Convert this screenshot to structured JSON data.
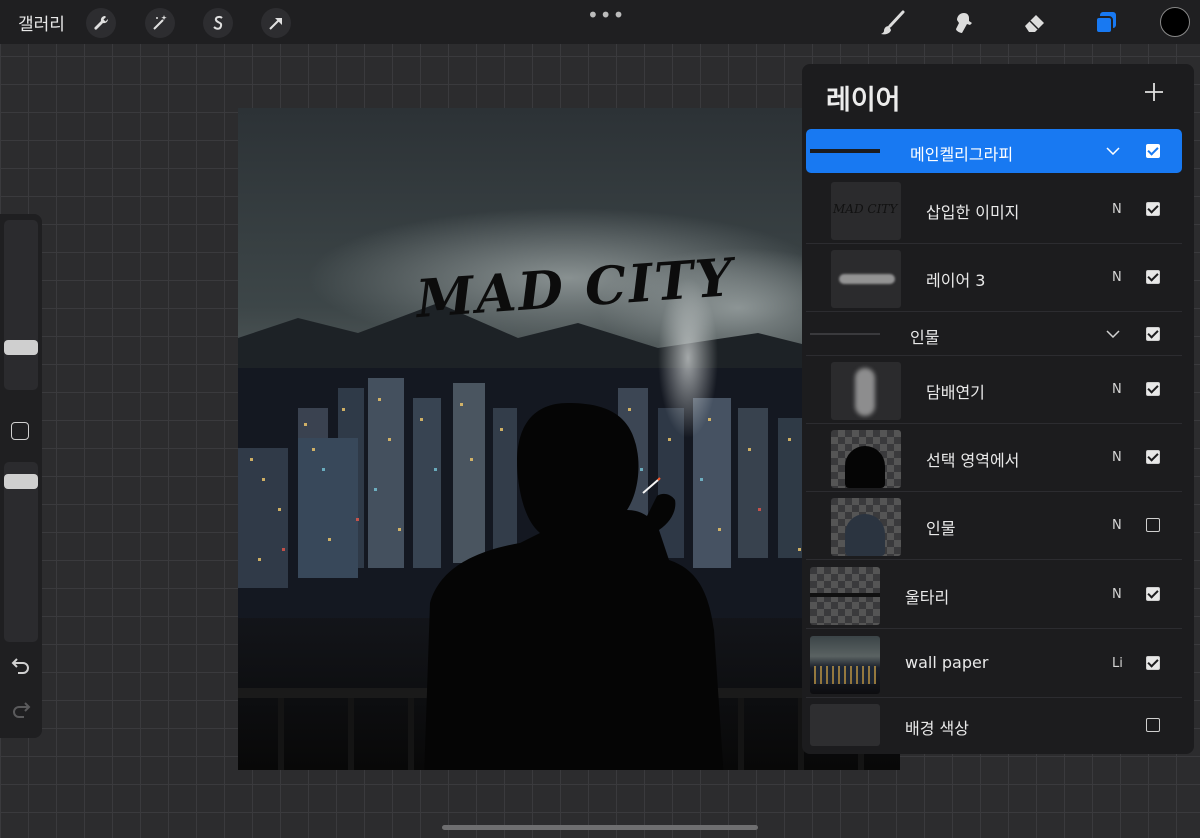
{
  "topbar": {
    "gallery_label": "갤러리",
    "more_glyph": "•••",
    "left_tools": [
      "wrench-icon",
      "magic-wand-icon",
      "selection-s-icon",
      "arrow-transform-icon"
    ],
    "right_tools": [
      "brush-icon",
      "smudge-icon",
      "eraser-icon",
      "layers-icon"
    ],
    "current_color": "#000000",
    "accent": "#1879f2"
  },
  "artwork": {
    "title_text": "MAD CITY"
  },
  "layers_panel": {
    "title": "레이어",
    "add_glyph": "+",
    "layers": [
      {
        "name": "메인켈리그라피",
        "mode": "",
        "visible": true,
        "group": true,
        "selected": true
      },
      {
        "name": "삽입한 이미지",
        "mode": "N",
        "visible": true,
        "thumb_text": "MAD CITY"
      },
      {
        "name": "레이어 3",
        "mode": "N",
        "visible": true
      },
      {
        "name": "인물",
        "mode": "",
        "visible": true,
        "group": true
      },
      {
        "name": "담배연기",
        "mode": "N",
        "visible": true
      },
      {
        "name": "선택 영역에서",
        "mode": "N",
        "visible": true
      },
      {
        "name": "인물",
        "mode": "N",
        "visible": false
      },
      {
        "name": "울타리",
        "mode": "N",
        "visible": true
      },
      {
        "name": "wall paper",
        "mode": "Li",
        "visible": true
      },
      {
        "name": "배경 색상",
        "mode": "",
        "visible": false
      }
    ]
  }
}
